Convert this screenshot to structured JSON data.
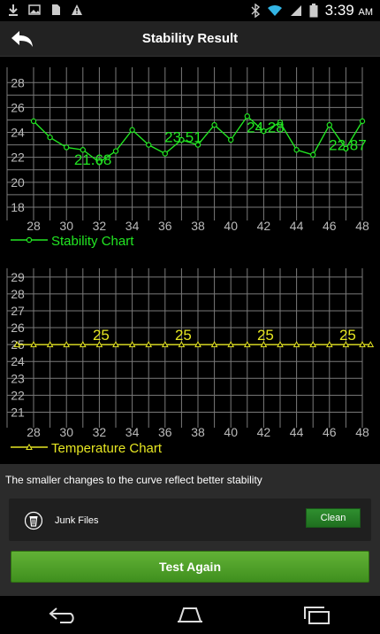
{
  "status_bar": {
    "time": "3:39",
    "ampm": "AM",
    "left_icons": [
      "download-icon",
      "image-icon",
      "sd-card-icon",
      "warning-icon"
    ],
    "right_icons": [
      "bluetooth-icon",
      "wifi-icon",
      "signal-icon",
      "battery-icon"
    ]
  },
  "header": {
    "title": "Stability Result",
    "back_icon": "back-arrow-icon"
  },
  "chart_data": [
    {
      "type": "line",
      "title": "",
      "legend": "Stability Chart",
      "color": "#22e622",
      "x": [
        28,
        29,
        30,
        31,
        32,
        33,
        34,
        35,
        36,
        37,
        38,
        39,
        40,
        41,
        42,
        43,
        44,
        45,
        46,
        47,
        48
      ],
      "y": [
        24.9,
        23.6,
        22.8,
        22.6,
        21.6,
        22.5,
        24.2,
        23.0,
        22.3,
        23.4,
        23.0,
        24.6,
        23.4,
        25.3,
        24.1,
        24.8,
        22.6,
        22.2,
        24.6,
        22.7,
        24.9
      ],
      "annotations": [
        {
          "x": 31.5,
          "y": 21.68,
          "text": "21.68"
        },
        {
          "x": 37,
          "y": 23.51,
          "text": "23.51"
        },
        {
          "x": 42,
          "y": 24.28,
          "text": "24.28"
        },
        {
          "x": 47,
          "y": 22.87,
          "text": "22.87"
        }
      ],
      "xticks": [
        "28",
        "30",
        "32",
        "34",
        "36",
        "38",
        "40",
        "42",
        "44",
        "46",
        "48"
      ],
      "yticks": [
        "18",
        "20",
        "22",
        "24",
        "26",
        "28"
      ],
      "xlim": [
        28,
        48
      ],
      "ylim": [
        17.5,
        28.8
      ],
      "grid": true
    },
    {
      "type": "line",
      "title": "",
      "legend": "Temperature Chart",
      "color": "#e6e622",
      "x": [
        27,
        28,
        29,
        30,
        31,
        32,
        33,
        34,
        35,
        36,
        37,
        38,
        39,
        40,
        41,
        42,
        43,
        44,
        45,
        46,
        47,
        48,
        48.5
      ],
      "y": [
        25,
        25,
        25,
        25,
        25,
        25,
        25,
        25,
        25,
        25,
        25,
        25,
        25,
        25,
        25,
        25,
        25,
        25,
        25,
        25,
        25,
        25,
        25
      ],
      "annotations": [
        {
          "x": 32,
          "y": 25,
          "text": "25"
        },
        {
          "x": 37,
          "y": 25,
          "text": "25"
        },
        {
          "x": 42,
          "y": 25,
          "text": "25"
        },
        {
          "x": 47,
          "y": 25,
          "text": "25"
        }
      ],
      "xticks": [
        "28",
        "30",
        "32",
        "34",
        "36",
        "38",
        "40",
        "42",
        "44",
        "46",
        "48"
      ],
      "yticks": [
        "21",
        "22",
        "23",
        "24",
        "25",
        "26",
        "27",
        "28",
        "29"
      ],
      "xlim": [
        28,
        48
      ],
      "ylim": [
        20.5,
        29.2
      ],
      "grid": true
    }
  ],
  "hint_text": "The smaller changes to the curve reflect better stability",
  "junk": {
    "label": "Junk Files",
    "icon": "trash-icon",
    "button_label": "Clean"
  },
  "action": {
    "button_label": "Test Again"
  },
  "nav_bar": {
    "buttons": [
      "back-icon",
      "home-icon",
      "recent-apps-icon"
    ]
  }
}
